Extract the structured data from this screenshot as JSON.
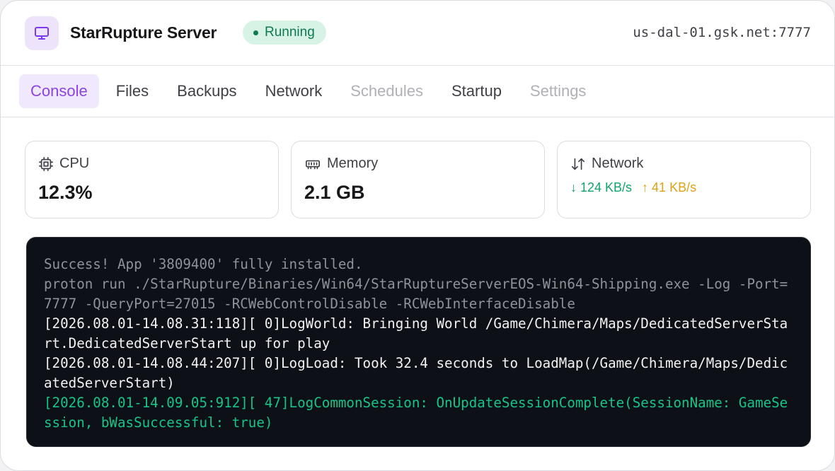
{
  "header": {
    "server_name": "StarRupture Server",
    "status": "Running",
    "address": "us-dal-01.gsk.net:7777",
    "icon": "monitor-icon"
  },
  "tabs": [
    {
      "label": "Console",
      "state": "active"
    },
    {
      "label": "Files",
      "state": "normal"
    },
    {
      "label": "Backups",
      "state": "normal"
    },
    {
      "label": "Network",
      "state": "normal"
    },
    {
      "label": "Schedules",
      "state": "disabled"
    },
    {
      "label": "Startup",
      "state": "normal"
    },
    {
      "label": "Settings",
      "state": "disabled"
    }
  ],
  "stats": {
    "cpu": {
      "label": "CPU",
      "value": "12.3%",
      "icon": "cpu-icon"
    },
    "memory": {
      "label": "Memory",
      "value": "2.1 GB",
      "icon": "memory-icon"
    },
    "network": {
      "label": "Network",
      "download": "↓ 124 KB/s",
      "upload": "↑ 41 KB/s",
      "icon": "arrows-up-down-icon"
    }
  },
  "console": {
    "lines": [
      {
        "text": "Success! App '3809400' fully installed.",
        "style": "muted"
      },
      {
        "text": "proton run ./StarRupture/Binaries/Win64/StarRuptureServerEOS-Win64-Shipping.exe -Log -Port=7777 -QueryPort=27015 -RCWebControlDisable -RCWebInterfaceDisable",
        "style": "muted"
      },
      {
        "text": "[2026.08.01-14.08.31:118][ 0]LogWorld: Bringing World /Game/Chimera/Maps/DedicatedServerStart.DedicatedServerStart up for play",
        "style": "normal"
      },
      {
        "text": "[2026.08.01-14.08.44:207][ 0]LogLoad: Took 32.4 seconds to LoadMap(/Game/Chimera/Maps/DedicatedServerStart)",
        "style": "normal"
      },
      {
        "text": "[2026.08.01-14.09.05:912][ 47]LogCommonSession: OnUpdateSessionComplete(SessionName: GameSession, bWasSuccessful: true)",
        "style": "success"
      }
    ]
  },
  "colors": {
    "accent": "#8b45e0",
    "running": "#10794d",
    "download": "#12a46a",
    "upload": "#e0a215",
    "console_bg": "#0d1016"
  }
}
